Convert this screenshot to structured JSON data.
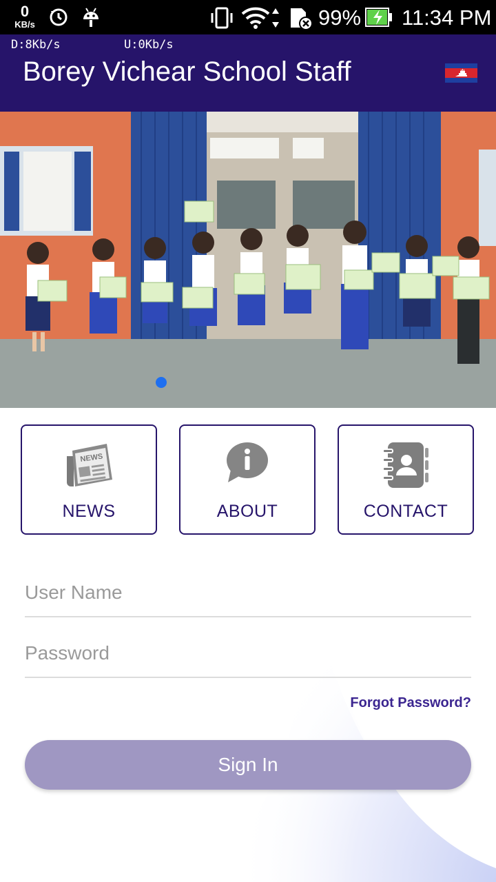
{
  "status_bar": {
    "kb_num": "0",
    "kb_unit": "KB/s",
    "battery_pct": "99%",
    "time": "11:34 PM",
    "icons": [
      "sync-icon",
      "android-icon",
      "vibrate-icon",
      "wifi-icon",
      "data-arrows-icon",
      "sd-card-error-icon",
      "battery-charging-icon"
    ]
  },
  "app_bar": {
    "net_down": "D:8Kb/s",
    "net_up": "U:0Kb/s",
    "title": "Borey Vichear School Staff",
    "language_flag": "cambodia-flag-icon"
  },
  "banner": {
    "description_icon": "class-photo-image",
    "active_slide": 1
  },
  "menu": {
    "tiles": [
      {
        "label": "NEWS",
        "icon": "newspaper-icon"
      },
      {
        "label": "ABOUT",
        "icon": "info-bubble-icon"
      },
      {
        "label": "CONTACT",
        "icon": "contact-book-icon"
      }
    ]
  },
  "login": {
    "username_placeholder": "User Name",
    "username_value": "",
    "password_placeholder": "Password",
    "password_value": "",
    "forgot_label": "Forgot Password?",
    "signin_label": "Sign In"
  },
  "colors": {
    "primary": "#26146a",
    "signin_bg": "#9f97c2",
    "link": "#3b2590",
    "carousel_dot": "#1e6ff0"
  }
}
